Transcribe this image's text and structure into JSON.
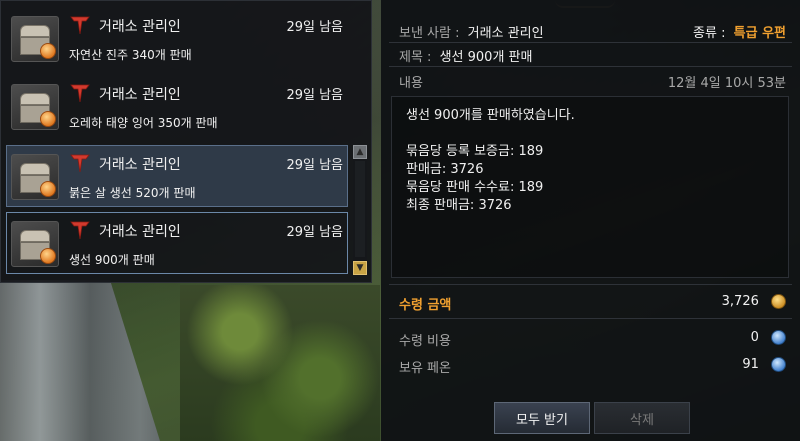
{
  "mail_list": {
    "items": [
      {
        "sender": "거래소 관리인",
        "days_left": "29일 남음",
        "subject": "자연산 진주 340개 판매",
        "selected": false
      },
      {
        "sender": "거래소 관리인",
        "days_left": "29일 남음",
        "subject": "오레하 태양 잉어 350개 판매",
        "selected": false
      },
      {
        "sender": "거래소 관리인",
        "days_left": "29일 남음",
        "subject": "붉은 살 생선 520개 판매",
        "selected": true
      },
      {
        "sender": "거래소 관리인",
        "days_left": "29일 남음",
        "subject": "생선 900개 판매",
        "selected": false
      }
    ]
  },
  "detail": {
    "sender_label": "보낸 사람 :",
    "sender_value": "거래소 관리인",
    "type_label": "종류 :",
    "type_value": "특급 우편",
    "subject_label": "제목 :",
    "subject_value": "생선 900개 판매",
    "content_label": "내용",
    "timestamp": "12월 4일 10시 53분",
    "body_lines": [
      "생선 900개를 판매하였습니다.",
      "",
      "묶음당 등록 보증금: 189",
      "판매금: 3726",
      "묶음당 판매 수수료: 189",
      "최종 판매금: 3726"
    ],
    "receive_amount_label": "수령 금액",
    "receive_amount_value": "3,726",
    "receive_cost_label": "수령 비용",
    "receive_cost_value": "0",
    "owned_label": "보유 페온",
    "owned_value": "91",
    "receive_all_button": "모두 받기",
    "delete_button": "삭제"
  },
  "colors": {
    "accent_orange": "#f0a030",
    "selected_bg": "#465870",
    "gold_coin": "#c98a20",
    "blue_coin": "#3b7ac9"
  },
  "icons": {
    "mail_item_icon": "treasure-chest-icon",
    "sender_logo": "trade-post-logo-icon",
    "gold_icon": "gold-coin-icon",
    "pheon_icon": "pheon-icon"
  }
}
